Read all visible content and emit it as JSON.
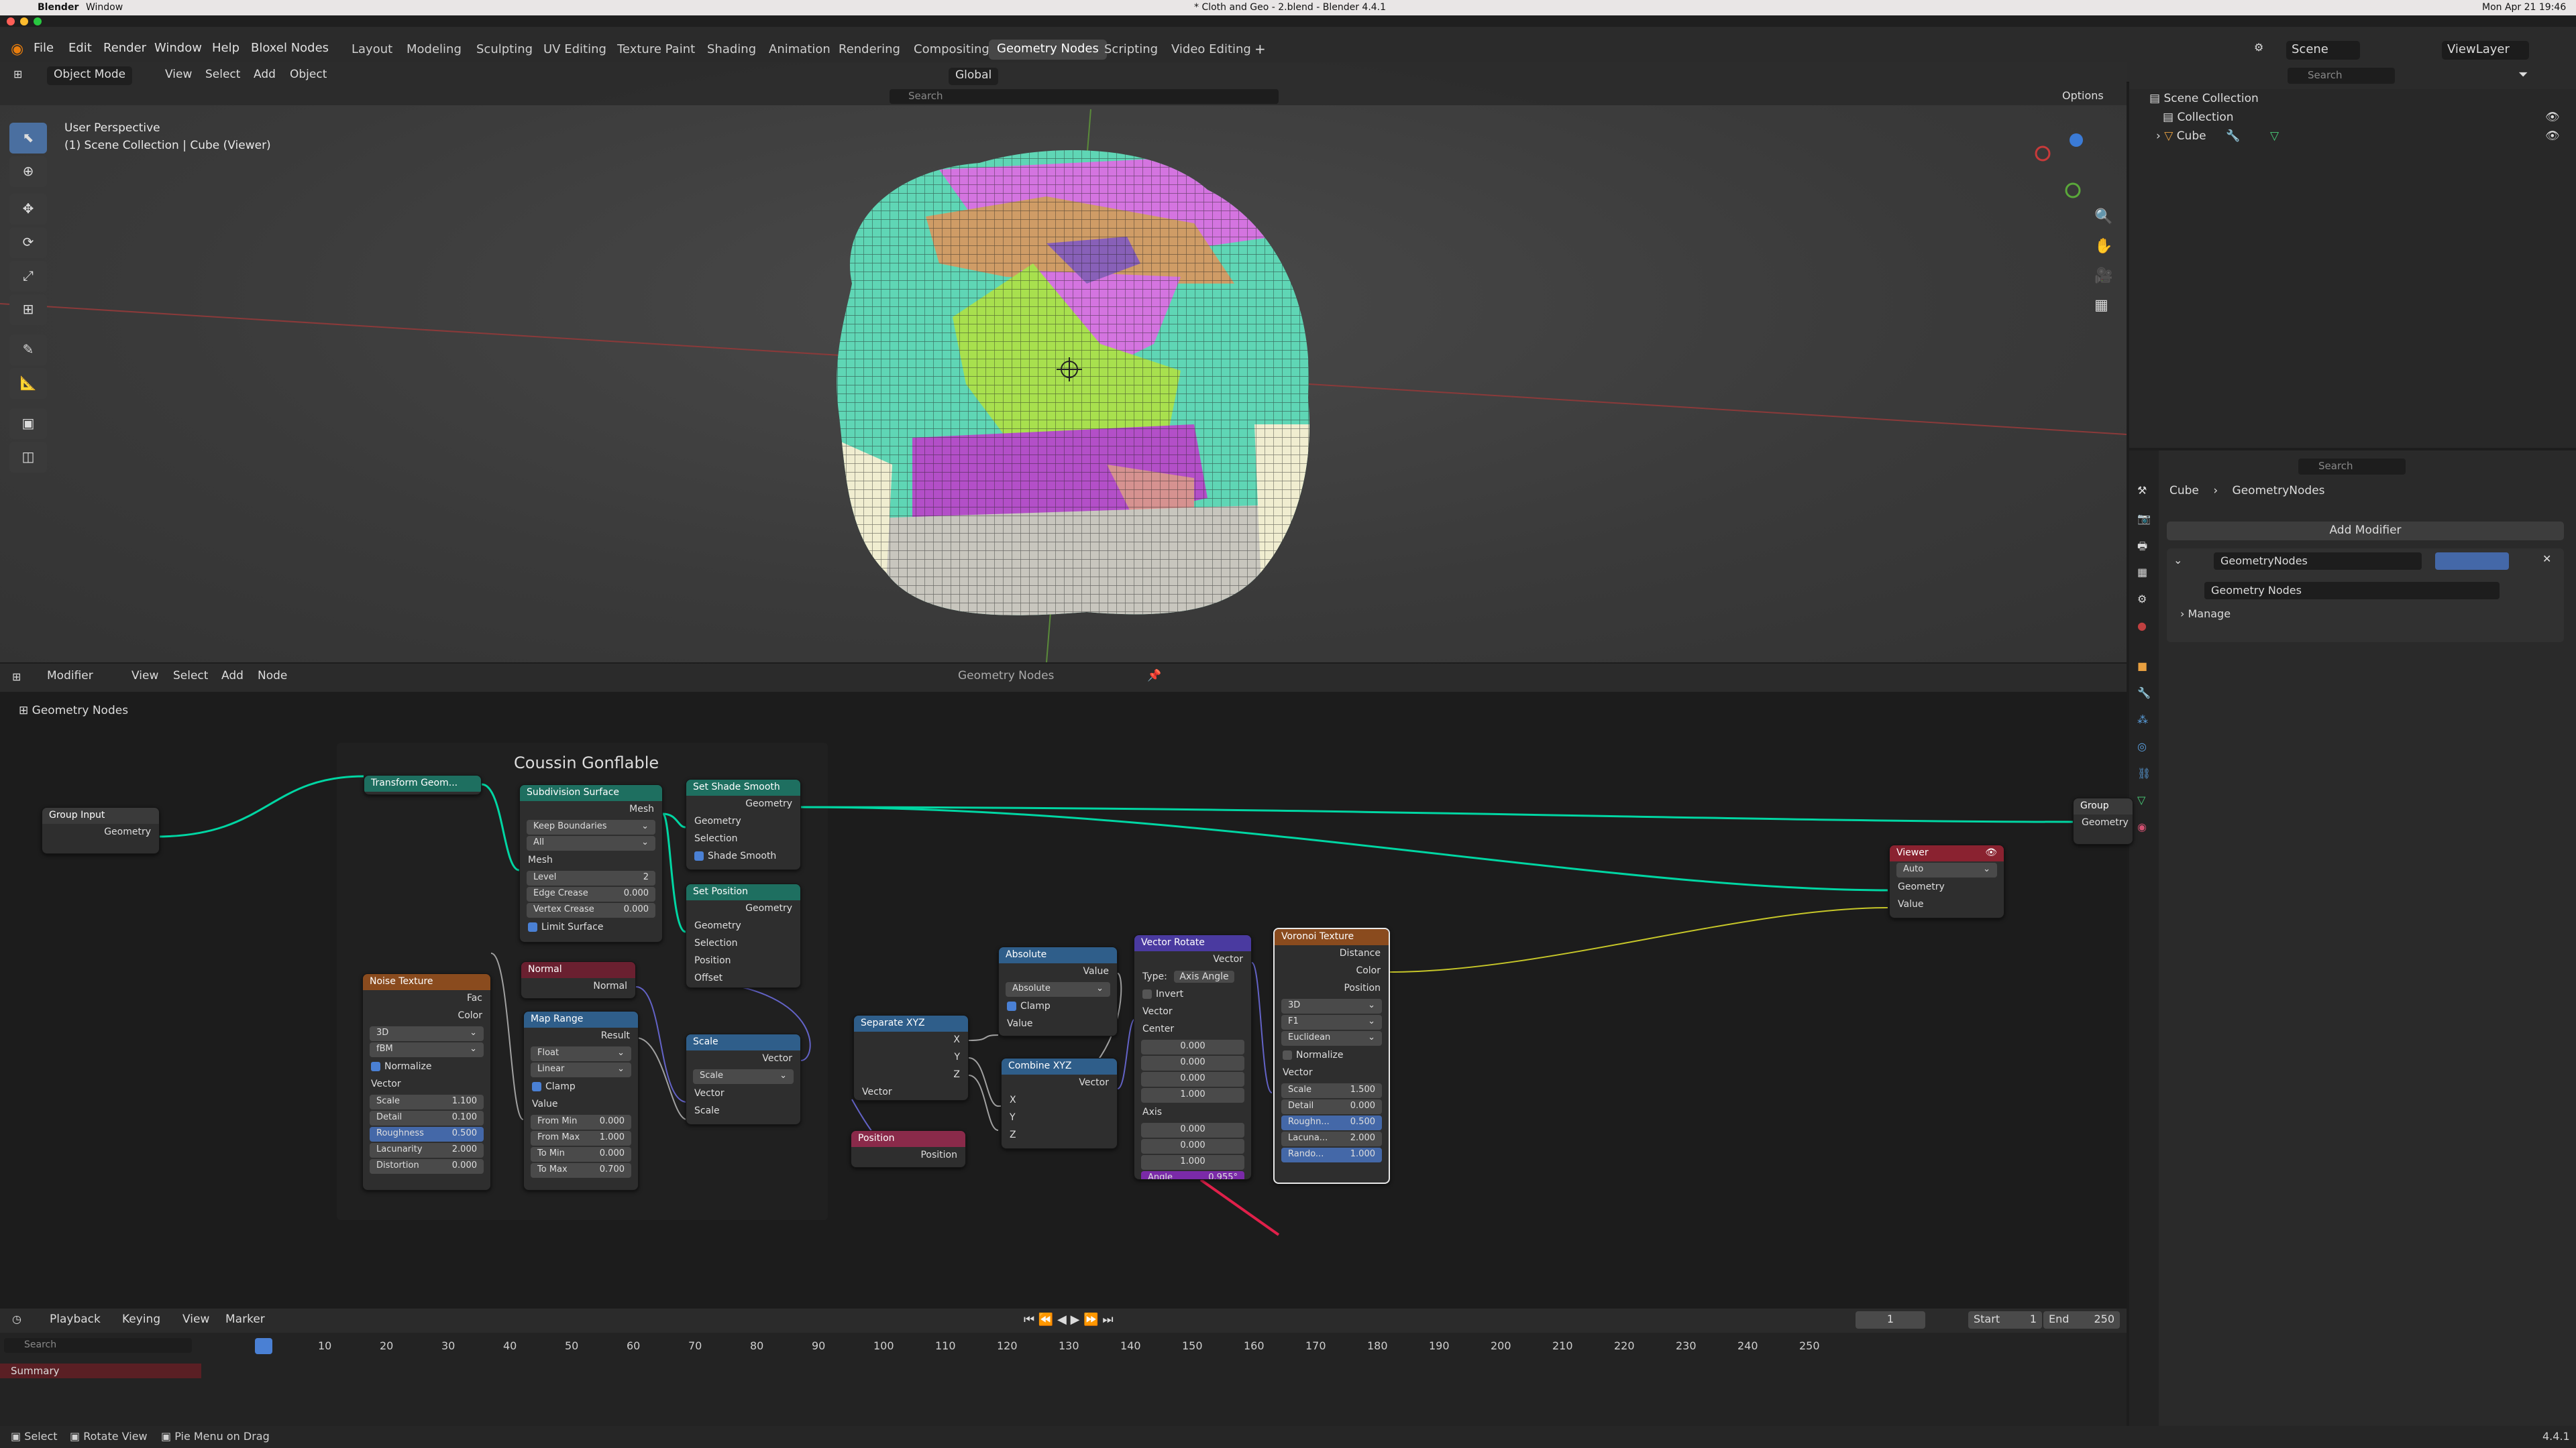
{
  "macos": {
    "apple": "",
    "app": "Blender",
    "window_menu": "Window",
    "title": "* Cloth and Geo - 2.blend - Blender 4.4.1",
    "clock": "Mon Apr 21 19:46"
  },
  "menubar": {
    "items": [
      "File",
      "Edit",
      "Render",
      "Window",
      "Help",
      "Bloxel Nodes"
    ]
  },
  "workspaces": {
    "tabs": [
      "Layout",
      "Modeling",
      "Sculpting",
      "UV Editing",
      "Texture Paint",
      "Shading",
      "Animation",
      "Rendering",
      "Compositing",
      "Geometry Nodes",
      "Scripting",
      "Video Editing"
    ],
    "active": "Geometry Nodes"
  },
  "scene": {
    "label": "Scene",
    "view_layer": "ViewLayer"
  },
  "viewport": {
    "mode": "Object Mode",
    "menus": [
      "View",
      "Select",
      "Add",
      "Object"
    ],
    "orientation": "Global",
    "overlay_title": "User Perspective",
    "overlay_sub": "(1) Scene Collection | Cube (Viewer)",
    "options": "Options",
    "search_placeholder": "Search"
  },
  "outliner": {
    "search_placeholder": "Search",
    "items": [
      {
        "label": "Scene Collection"
      },
      {
        "label": "Collection"
      },
      {
        "label": "Cube"
      }
    ]
  },
  "properties": {
    "search_placeholder": "Search",
    "breadcrumb": [
      "Cube",
      "GeometryNodes"
    ],
    "add_modifier": "Add Modifier",
    "modifier_name": "GeometryNodes",
    "node_group": "Geometry Nodes",
    "manage": "Manage"
  },
  "node_editor": {
    "menus": [
      "Modifier",
      "View",
      "Select",
      "Add",
      "Node"
    ],
    "tree_name": "Geometry Nodes",
    "breadcrumb": "Geometry Nodes",
    "frame_label": "Coussin Gonflable"
  },
  "nodes": {
    "group_input": {
      "title": "Group Input",
      "out": "Geometry"
    },
    "group_output": {
      "title": "Group",
      "in": "Geometry"
    },
    "transform": {
      "title": "Transform Geom..."
    },
    "subdiv": {
      "title": "Subdivision Surface",
      "mesh_out": "Mesh",
      "boundary": "Keep Boundaries",
      "all": "All",
      "mesh_in": "Mesh",
      "level_label": "Level",
      "level": "2",
      "edge_label": "Edge Crease",
      "edge": "0.000",
      "vertex_label": "Vertex Crease",
      "vertex": "0.000",
      "limit": "Limit Surface"
    },
    "shade_smooth": {
      "title": "Set Shade Smooth",
      "geo_out": "Geometry",
      "geo_in": "Geometry",
      "selection": "Selection",
      "shade": "Shade Smooth"
    },
    "set_position": {
      "title": "Set Position",
      "geo_out": "Geometry",
      "geo_in": "Geometry",
      "selection": "Selection",
      "position": "Position",
      "offset": "Offset"
    },
    "normal": {
      "title": "Normal",
      "out": "Normal"
    },
    "noise": {
      "title": "Noise Texture",
      "fac": "Fac",
      "color": "Color",
      "dim": "3D",
      "type": "fBM",
      "normalize": "Normalize",
      "vector": "Vector",
      "scale_l": "Scale",
      "scale": "1.100",
      "detail_l": "Detail",
      "detail": "0.100",
      "rough_l": "Roughness",
      "rough": "0.500",
      "lac_l": "Lacunarity",
      "lac": "2.000",
      "dist_l": "Distortion",
      "dist": "0.000"
    },
    "map_range": {
      "title": "Map Range",
      "result": "Result",
      "type": "Float",
      "interp": "Linear",
      "clamp": "Clamp",
      "value": "Value",
      "fmin_l": "From Min",
      "fmin": "0.000",
      "fmax_l": "From Max",
      "fmax": "1.000",
      "tmin_l": "To Min",
      "tmin": "0.000",
      "tmax_l": "To Max",
      "tmax": "0.700"
    },
    "scale": {
      "title": "Scale",
      "vector_out": "Vector",
      "op": "Scale",
      "vector_in": "Vector",
      "scale_in": "Scale"
    },
    "separate": {
      "title": "Separate XYZ",
      "x": "X",
      "y": "Y",
      "z": "Z",
      "vector": "Vector"
    },
    "position": {
      "title": "Position",
      "out": "Position"
    },
    "absolute": {
      "title": "Absolute",
      "value_out": "Value",
      "op": "Absolute",
      "clamp": "Clamp",
      "value_in": "Value"
    },
    "combine": {
      "title": "Combine XYZ",
      "vector": "Vector",
      "x": "X",
      "y": "Y",
      "z": "Z"
    },
    "rotate": {
      "title": "Vector Rotate",
      "vector_out": "Vector",
      "type_l": "Type:",
      "type": "Axis Angle",
      "invert": "Invert",
      "vector_in": "Vector",
      "center": "Center",
      "c1": "0.000",
      "c2": "0.000",
      "c3": "0.000",
      "c4": "1.000",
      "axis": "Axis",
      "a1": "0.000",
      "a2": "0.000",
      "a3": "1.000",
      "angle_l": "Angle",
      "angle": "0.955°"
    },
    "voronoi": {
      "title": "Voronoi Texture",
      "distance": "Distance",
      "color": "Color",
      "position": "Position",
      "dim": "3D",
      "feature": "F1",
      "metric": "Euclidean",
      "normalize": "Normalize",
      "vector": "Vector",
      "scale_l": "Scale",
      "scale": "1.500",
      "detail_l": "Detail",
      "detail": "0.000",
      "rough_l": "Roughn...",
      "rough": "0.500",
      "lac_l": "Lacuna...",
      "lac": "2.000",
      "rand_l": "Rando...",
      "rand": "1.000"
    },
    "viewer": {
      "title": "Viewer",
      "domain": "Auto",
      "geometry": "Geometry",
      "value": "Value"
    }
  },
  "timeline": {
    "menus": [
      "Playback",
      "Keying",
      "View",
      "Marker"
    ],
    "current": "1",
    "start_l": "Start",
    "start": "1",
    "end_l": "End",
    "end": "250",
    "ticks": [
      "1",
      "10",
      "20",
      "30",
      "40",
      "50",
      "60",
      "70",
      "80",
      "90",
      "100",
      "110",
      "120",
      "130",
      "140",
      "150",
      "160",
      "170",
      "180",
      "190",
      "200",
      "210",
      "220",
      "230",
      "240",
      "250"
    ],
    "summary": "Summary",
    "search_placeholder": "Search"
  },
  "statusbar": {
    "select": "Select",
    "rotate": "Rotate View",
    "pie": "Pie Menu on Drag",
    "version": "4.4.1"
  }
}
